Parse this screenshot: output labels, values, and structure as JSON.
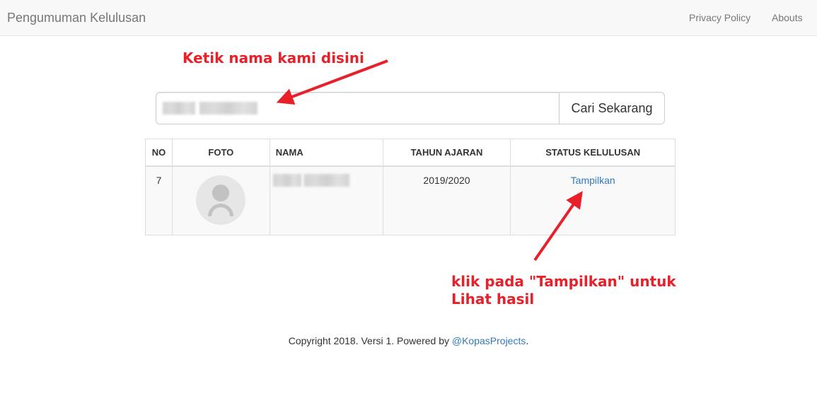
{
  "navbar": {
    "brand": "Pengumuman Kelulusan",
    "links": [
      {
        "label": "Privacy Policy"
      },
      {
        "label": "Abouts"
      }
    ]
  },
  "search": {
    "value": "",
    "button_label": "Cari Sekarang"
  },
  "table": {
    "headers": [
      "NO",
      "FOTO",
      "NAMA",
      "TAHUN AJARAN",
      "STATUS KELULUSAN"
    ],
    "rows": [
      {
        "no": "7",
        "foto": "avatar-placeholder-icon",
        "nama": "",
        "tahun_ajaran": "2019/2020",
        "status_link": "Tampilkan"
      }
    ]
  },
  "annotations": {
    "top": "Ketik nama kami disini",
    "bottom": "klik pada \"Tampilkan\" untuk Lihat hasil"
  },
  "footer": {
    "text": "Copyright 2018. Versi 1. Powered by ",
    "link": "@KopasProjects",
    "suffix": "."
  },
  "colors": {
    "link": "#337ab7",
    "annotation": "#e8202a",
    "navbar_bg": "#f8f8f8"
  }
}
